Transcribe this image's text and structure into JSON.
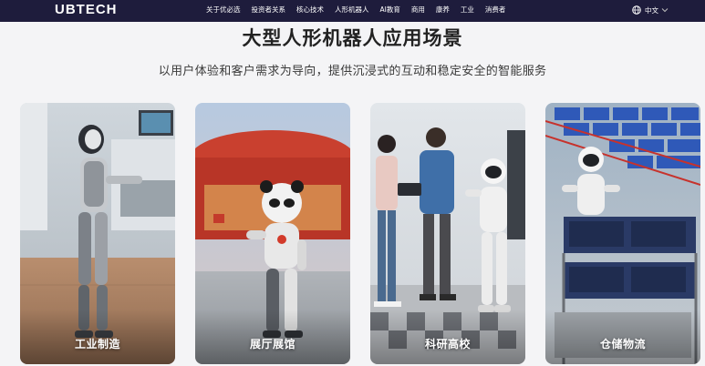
{
  "header": {
    "logo": "UBTECH",
    "nav": [
      "关于优必选",
      "投资者关系",
      "核心技术",
      "人形机器人",
      "AI教育",
      "商用",
      "康养",
      "工业",
      "消费者"
    ],
    "language": "中文"
  },
  "hero": {
    "title": "大型人形机器人应用场景",
    "subtitle": "以用户体验和客户需求为导向，提供沉浸式的互动和稳定安全的智能服务"
  },
  "cards": [
    {
      "label": "工业制造"
    },
    {
      "label": "展厅展馆"
    },
    {
      "label": "科研高校"
    },
    {
      "label": "仓储物流"
    }
  ],
  "colors": {
    "nav_bg": "#1e1c3c",
    "page_bg": "#f4f4f6",
    "text_dark": "#222222"
  }
}
